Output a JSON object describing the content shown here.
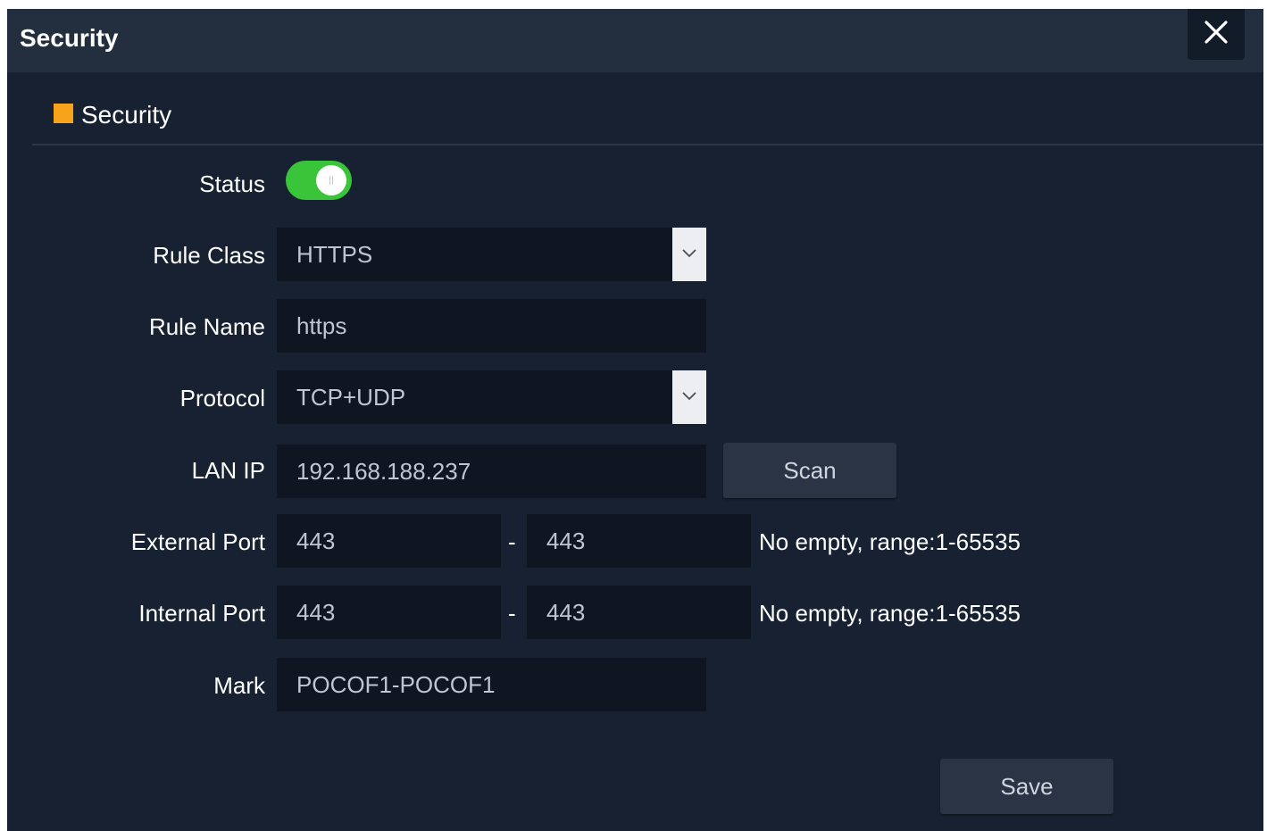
{
  "dialog": {
    "title": "Security",
    "close_icon": "close-icon"
  },
  "section": {
    "title": "Security",
    "accent_color": "#f7a41b"
  },
  "form": {
    "status": {
      "label": "Status",
      "enabled": true,
      "toggle_color": "#3ac43a"
    },
    "rule_class": {
      "label": "Rule Class",
      "value": "HTTPS"
    },
    "rule_name": {
      "label": "Rule Name",
      "value": "https"
    },
    "protocol": {
      "label": "Protocol",
      "value": "TCP+UDP"
    },
    "lan_ip": {
      "label": "LAN IP",
      "value": "192.168.188.237",
      "scan_label": "Scan"
    },
    "external_port": {
      "label": "External Port",
      "from": "443",
      "to": "443",
      "separator": "-",
      "hint": "No empty, range:1-65535"
    },
    "internal_port": {
      "label": "Internal Port",
      "from": "443",
      "to": "443",
      "separator": "-",
      "hint": "No empty, range:1-65535"
    },
    "mark": {
      "label": "Mark",
      "value": "POCOF1-POCOF1"
    }
  },
  "actions": {
    "save_label": "Save"
  }
}
